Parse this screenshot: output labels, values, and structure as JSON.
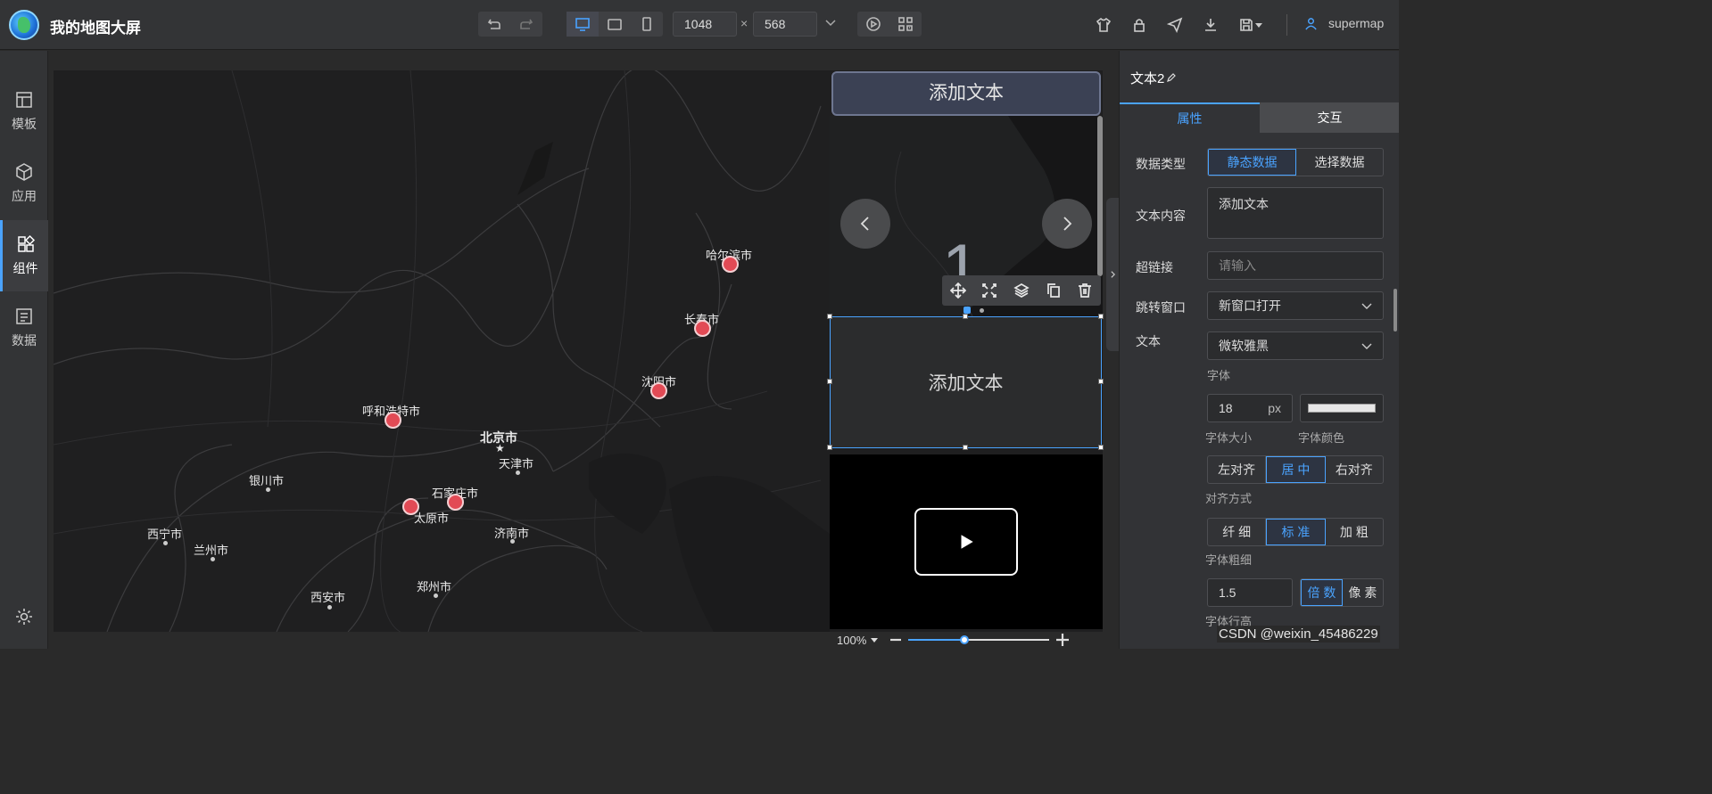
{
  "app": {
    "title": "我的地图大屏",
    "user": "supermap",
    "accent": "#4aa3ff"
  },
  "toolbar": {
    "width": "1048",
    "height": "568",
    "times": "×"
  },
  "nav": [
    {
      "label": "模板",
      "icon": "template-icon"
    },
    {
      "label": "应用",
      "icon": "cube-icon"
    },
    {
      "label": "组件",
      "icon": "component-icon"
    },
    {
      "label": "数据",
      "icon": "data-list-icon"
    }
  ],
  "map": {
    "cities": [
      "哈尔滨市",
      "长春市",
      "沈阳市",
      "呼和浩特市",
      "北京市",
      "天津市",
      "银川市",
      "石家庄市",
      "太原市",
      "西宁市",
      "兰州市",
      "济南市",
      "郑州市",
      "西安市"
    ]
  },
  "widgets": {
    "title_text": "添加文本",
    "carousel_number": "1",
    "textbox_text": "添加文本",
    "zoom": "100%"
  },
  "props": {
    "name": "文本2",
    "tabs": [
      "属性",
      "交互"
    ],
    "data_type_label": "数据类型",
    "data_type_options": [
      "静态数据",
      "选择数据"
    ],
    "text_content_label": "文本内容",
    "text_content_value": "添加文本",
    "link_label": "超链接",
    "link_placeholder": "请输入",
    "jump_label": "跳转窗口",
    "jump_value": "新窗口打开",
    "text_label": "文本",
    "font_value": "微软雅黑",
    "font_sub": "字体",
    "font_size": "18",
    "font_size_unit": "px",
    "font_size_sub": "字体大小",
    "font_color_sub": "字体颜色",
    "align_options": [
      "左对齐",
      "居 中",
      "右对齐"
    ],
    "align_sub": "对齐方式",
    "weight_options": [
      "纤 细",
      "标 准",
      "加 粗"
    ],
    "weight_sub": "字体粗细",
    "line_height": "1.5",
    "line_height_units": [
      "倍 数",
      "像 素"
    ],
    "line_height_sub": "字体行高"
  },
  "watermark": "CSDN @weixin_45486229"
}
